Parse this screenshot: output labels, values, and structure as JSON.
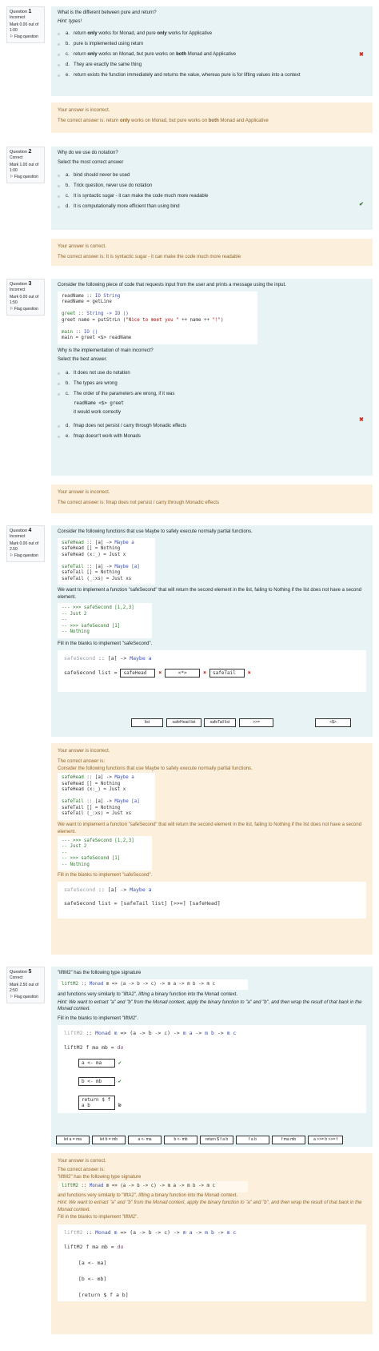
{
  "questions": [
    {
      "label": "Question",
      "number": "1",
      "state": "Incorrect",
      "mark": "Mark 0.00 out of 1:00",
      "flag": "Flag question",
      "text": "What is the different between pure and return?",
      "hint": "Hint: types!",
      "answers": [
        {
          "letter": "a.",
          "text": "return only works for Monad, and pure only works for Applicative"
        },
        {
          "letter": "b.",
          "text": "pure is implemented using return"
        },
        {
          "letter": "c.",
          "text": "return only works on Monad, but pure works on both Monad and Applicative"
        },
        {
          "letter": "d.",
          "text": "They are exactly the same thing"
        },
        {
          "letter": "e.",
          "text": "return exists the function immediately and returns the value, whereas pure is for lifting values into a context"
        }
      ],
      "feedback": "Your answer is incorrect.",
      "correct": "The correct answer is: return only works on Monad, but pure works on both Monad and Applicative"
    },
    {
      "label": "Question",
      "number": "2",
      "state": "Correct",
      "mark": "Mark 1.00 out of 1:00",
      "flag": "Flag question",
      "text": "Why do we use do notation?",
      "sub": "Select the most correct answer",
      "answers": [
        {
          "letter": "a.",
          "text": "bind should never be used"
        },
        {
          "letter": "b.",
          "text": "Trick question, never use do notation"
        },
        {
          "letter": "c.",
          "text": "It is syntactic sugar - it can make the code much more readable"
        },
        {
          "letter": "d.",
          "text": "It is computationally more efficient than using bind"
        }
      ],
      "feedback": "Your answer is correct.",
      "correct": "The correct answer is: It is syntactic sugar - it can make the code much more readable"
    },
    {
      "label": "Question",
      "number": "3",
      "state": "Incorrect",
      "mark": "Mark 0.00 out of 1:50",
      "flag": "Flag question",
      "text": "Consider the following piece of code that requests input from the user and prints a message using the input.",
      "q": "Why is the implementation of main incorrect?",
      "sub": "Select the best answer.",
      "answers": [
        {
          "letter": "a.",
          "text": "It does not use do notation"
        },
        {
          "letter": "b.",
          "text": "The types are wrong"
        },
        {
          "letter": "c.",
          "text": "The order of the parameters are wrong, if it was"
        },
        {
          "letter": "d.",
          "text": "fmap does not persist / carry through Monadic effects"
        },
        {
          "letter": "e.",
          "text": "fmap doesn't work with Monads"
        }
      ],
      "c_code": "readName <$> greet",
      "c_tail": "it would work correctly",
      "feedback": "Your answer is incorrect.",
      "correct": "The correct answer is: fmap does not persist / carry through Monadic effects"
    },
    {
      "label": "Question",
      "number": "4",
      "state": "Incorrect",
      "mark": "Mark 0.00 out of 2.50",
      "flag": "Flag question",
      "text": "Consider the following functions that use Maybe to safely execute normally partial functions.",
      "text2": "We want to implement a function \"safeSecond\" that will return the second element in the list, failing to Nothing if the list does not have a second element.",
      "text3": "Fill in the blanks to implement \"safeSecond\".",
      "slot1": "safeHead",
      "slot2": "<*>",
      "slot3": "safeTail",
      "chips": [
        "list",
        "safeHead list",
        "safeTail list",
        ">>=",
        "<$>"
      ],
      "feedback": "Your answer is incorrect.",
      "correct_label": "The correct answer is:",
      "answer_line": "safeSecond list = [safeTail list] [>>=] [safeHead]"
    },
    {
      "label": "Question",
      "number": "5",
      "state": "Correct",
      "mark": "Mark 2.50 out of 2:50",
      "flag": "Flag question",
      "text": "\"liftM2\" has the following type signature",
      "text2": "and functions very similarly to \"liftA2\", lifting a binary function into the Monad context.",
      "hint": "Hint: We want to extract \"a\" and \"b\" from the Monad context, apply the binary function to \"a\" and \"b\", and then wrap the result of that back in the Monad context.",
      "text3": "Fill in the blanks to implement \"liftM2\".",
      "slot1": "a <- ma",
      "slot2": "b <- mb",
      "slot3": "return $ f a b",
      "chips": [
        "let a = ma",
        "let b = mb",
        "a <- ma",
        "b <- mb",
        "return $ f a b",
        "f a b",
        "f ma mb",
        "a >>= b >>= f"
      ],
      "feedback": "Your answer is correct.",
      "correct_label": "The correct answer is:"
    }
  ]
}
